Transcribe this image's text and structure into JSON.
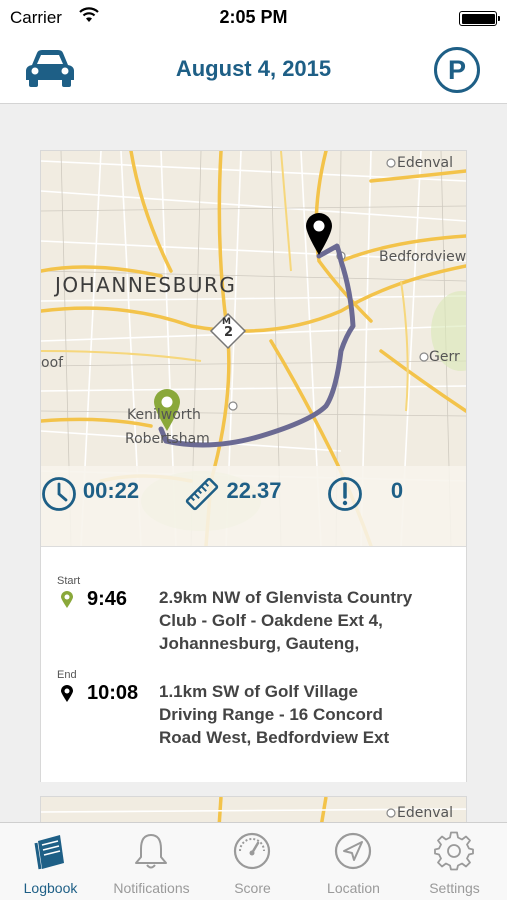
{
  "status_bar": {
    "carrier": "Carrier",
    "time": "2:05 PM"
  },
  "nav": {
    "title": "August 4, 2015",
    "left_icon": "car-icon",
    "right_icon": "parking-icon",
    "right_label": "P"
  },
  "trip_card": {
    "map": {
      "labels": {
        "city": "JOHANNESBURG",
        "edenvale": "Edenval",
        "bedfordview": "Bedfordview",
        "germiston": "Gerr",
        "left_partial": "oof",
        "kenilworth": "Kenilworth",
        "robertsham": "Robertsham",
        "highway": "M",
        "highway_number": "2"
      }
    },
    "stats": {
      "duration": "00:22",
      "distance": "22.37",
      "alerts": "0"
    },
    "start": {
      "label": "Start",
      "time": "9:46",
      "address_lines": [
        "2.9km NW of Glenvista Country",
        "Club - Golf - Oakdene Ext 4,",
        "Johannesburg, Gauteng,"
      ]
    },
    "end": {
      "label": "End",
      "time": "10:08",
      "address_lines": [
        "1.1km SW of Golf Village",
        "Driving Range - 16 Concord",
        "Road West, Bedfordview Ext"
      ]
    }
  },
  "next_card": {
    "map_label": "Edenval"
  },
  "tab_bar": {
    "tabs": [
      {
        "label": "Logbook",
        "icon": "logbook-icon",
        "active": true
      },
      {
        "label": "Notifications",
        "icon": "bell-icon",
        "active": false
      },
      {
        "label": "Score",
        "icon": "speedometer-icon",
        "active": false
      },
      {
        "label": "Location",
        "icon": "location-arrow-icon",
        "active": false
      },
      {
        "label": "Settings",
        "icon": "gear-icon",
        "active": false
      }
    ]
  },
  "colors": {
    "accent": "#1e5f86",
    "start_pin": "#8aa83a",
    "route": "#6b6a93",
    "road_major": "#f3c34a",
    "tab_inactive": "#9a9a9a"
  }
}
